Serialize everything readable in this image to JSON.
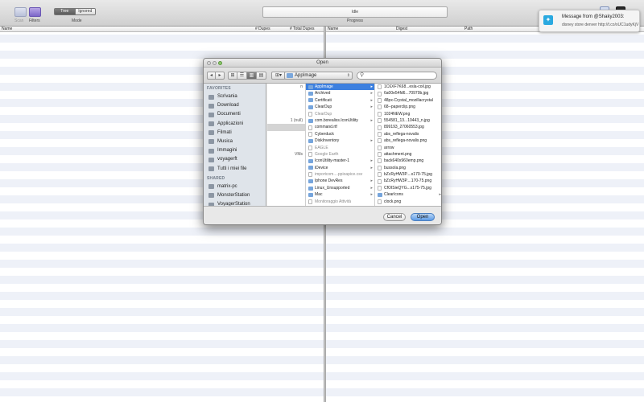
{
  "toolbar": {
    "scan_label": "Scan",
    "filters_label": "Filters",
    "mode_options": [
      "Tree",
      "Ignored"
    ],
    "mode_label": "Mode",
    "progress_status": "Idle",
    "progress_label": "Progress"
  },
  "left_table": {
    "columns": [
      "Name",
      "# Dupes",
      "# Total Dupes"
    ]
  },
  "right_table": {
    "columns": [
      "Name",
      "Digest",
      "Path"
    ]
  },
  "notification": {
    "title": "Message from @Shaky2003:",
    "body": "disney store denver http://t.co/xUC1udyKjV"
  },
  "dialog": {
    "title": "Open",
    "location": "AppImage",
    "search_placeholder": "",
    "sidebar": {
      "favorites_heading": "FAVORITES",
      "favorites": [
        "Scrivania",
        "Download",
        "Documenti",
        "Applicazioni",
        "Filmati",
        "Musica",
        "Immagini",
        "voyagerft",
        "Tutti i miei file"
      ],
      "shared_heading": "SHARED",
      "shared": [
        "matrix-pc",
        "MonsterStation",
        "VoyagerStation"
      ]
    },
    "col1": [
      "n",
      "",
      "",
      "",
      "",
      "1 (null)",
      "",
      "",
      "",
      "",
      "VMs",
      "",
      "",
      "",
      "",
      "",
      "",
      ""
    ],
    "col2": [
      {
        "name": "AppImage",
        "folder": true
      },
      {
        "name": "Archived",
        "folder": true
      },
      {
        "name": "Certificati",
        "folder": true
      },
      {
        "name": "ClearDup",
        "folder": true
      },
      {
        "name": "ClearDup",
        "folder": false,
        "faded": true
      },
      {
        "name": "com.borealiss.IconUtility",
        "folder": true
      },
      {
        "name": "command.rtf",
        "folder": false
      },
      {
        "name": "Cyberduck",
        "folder": false
      },
      {
        "name": "DiskInventory",
        "folder": true
      },
      {
        "name": "EAGLE",
        "folder": false,
        "faded": true
      },
      {
        "name": "Google Earth",
        "folder": false,
        "faded": true
      },
      {
        "name": "IconUtility-master-1",
        "folder": true
      },
      {
        "name": "iDevice",
        "folder": true
      },
      {
        "name": "importcom....ppioapice.csv",
        "folder": false,
        "faded": true
      },
      {
        "name": "Iphone DevRes",
        "folder": true
      },
      {
        "name": "Linux_Unsupported",
        "folder": true
      },
      {
        "name": "Mac",
        "folder": true
      },
      {
        "name": "Monitoraggio Attività",
        "folder": false,
        "faded": true
      },
      {
        "name": "NetBeans 7.1",
        "folder": false,
        "faded": true
      }
    ],
    "col3": [
      {
        "name": "1C6XF7K68...esla-coil.jpg",
        "folder": false
      },
      {
        "name": "6a00e54fd6...70970b.jpg",
        "folder": false
      },
      {
        "name": "48px-Crystal_mozillacrystal",
        "folder": false
      },
      {
        "name": "68--paperclip.png",
        "folder": false
      },
      {
        "name": "1024NEW.png",
        "folder": false
      },
      {
        "name": "554581_13...10443_n.jpg",
        "folder": false
      },
      {
        "name": "899193_27060553.jpg",
        "folder": false
      },
      {
        "name": "abs_reflega-novalis",
        "folder": false
      },
      {
        "name": "abs_reflega-novalis.png",
        "folder": false
      },
      {
        "name": "arrow",
        "folder": false
      },
      {
        "name": "attachment.png",
        "folder": false
      },
      {
        "name": "back640x960emp.png",
        "folder": false
      },
      {
        "name": "bussola.png",
        "folder": false
      },
      {
        "name": "bZcRyHW3P....x170-75.jpg",
        "folder": false
      },
      {
        "name": "bZcRyHW3P....170-75.png",
        "folder": false
      },
      {
        "name": "CfOISieQYG...x175-75.jpg",
        "folder": false
      },
      {
        "name": "ClearIcons",
        "folder": true
      },
      {
        "name": "clock.png",
        "folder": false
      },
      {
        "name": "compilatore.png",
        "folder": false
      }
    ],
    "cancel_label": "Cancel",
    "open_label": "Open"
  }
}
